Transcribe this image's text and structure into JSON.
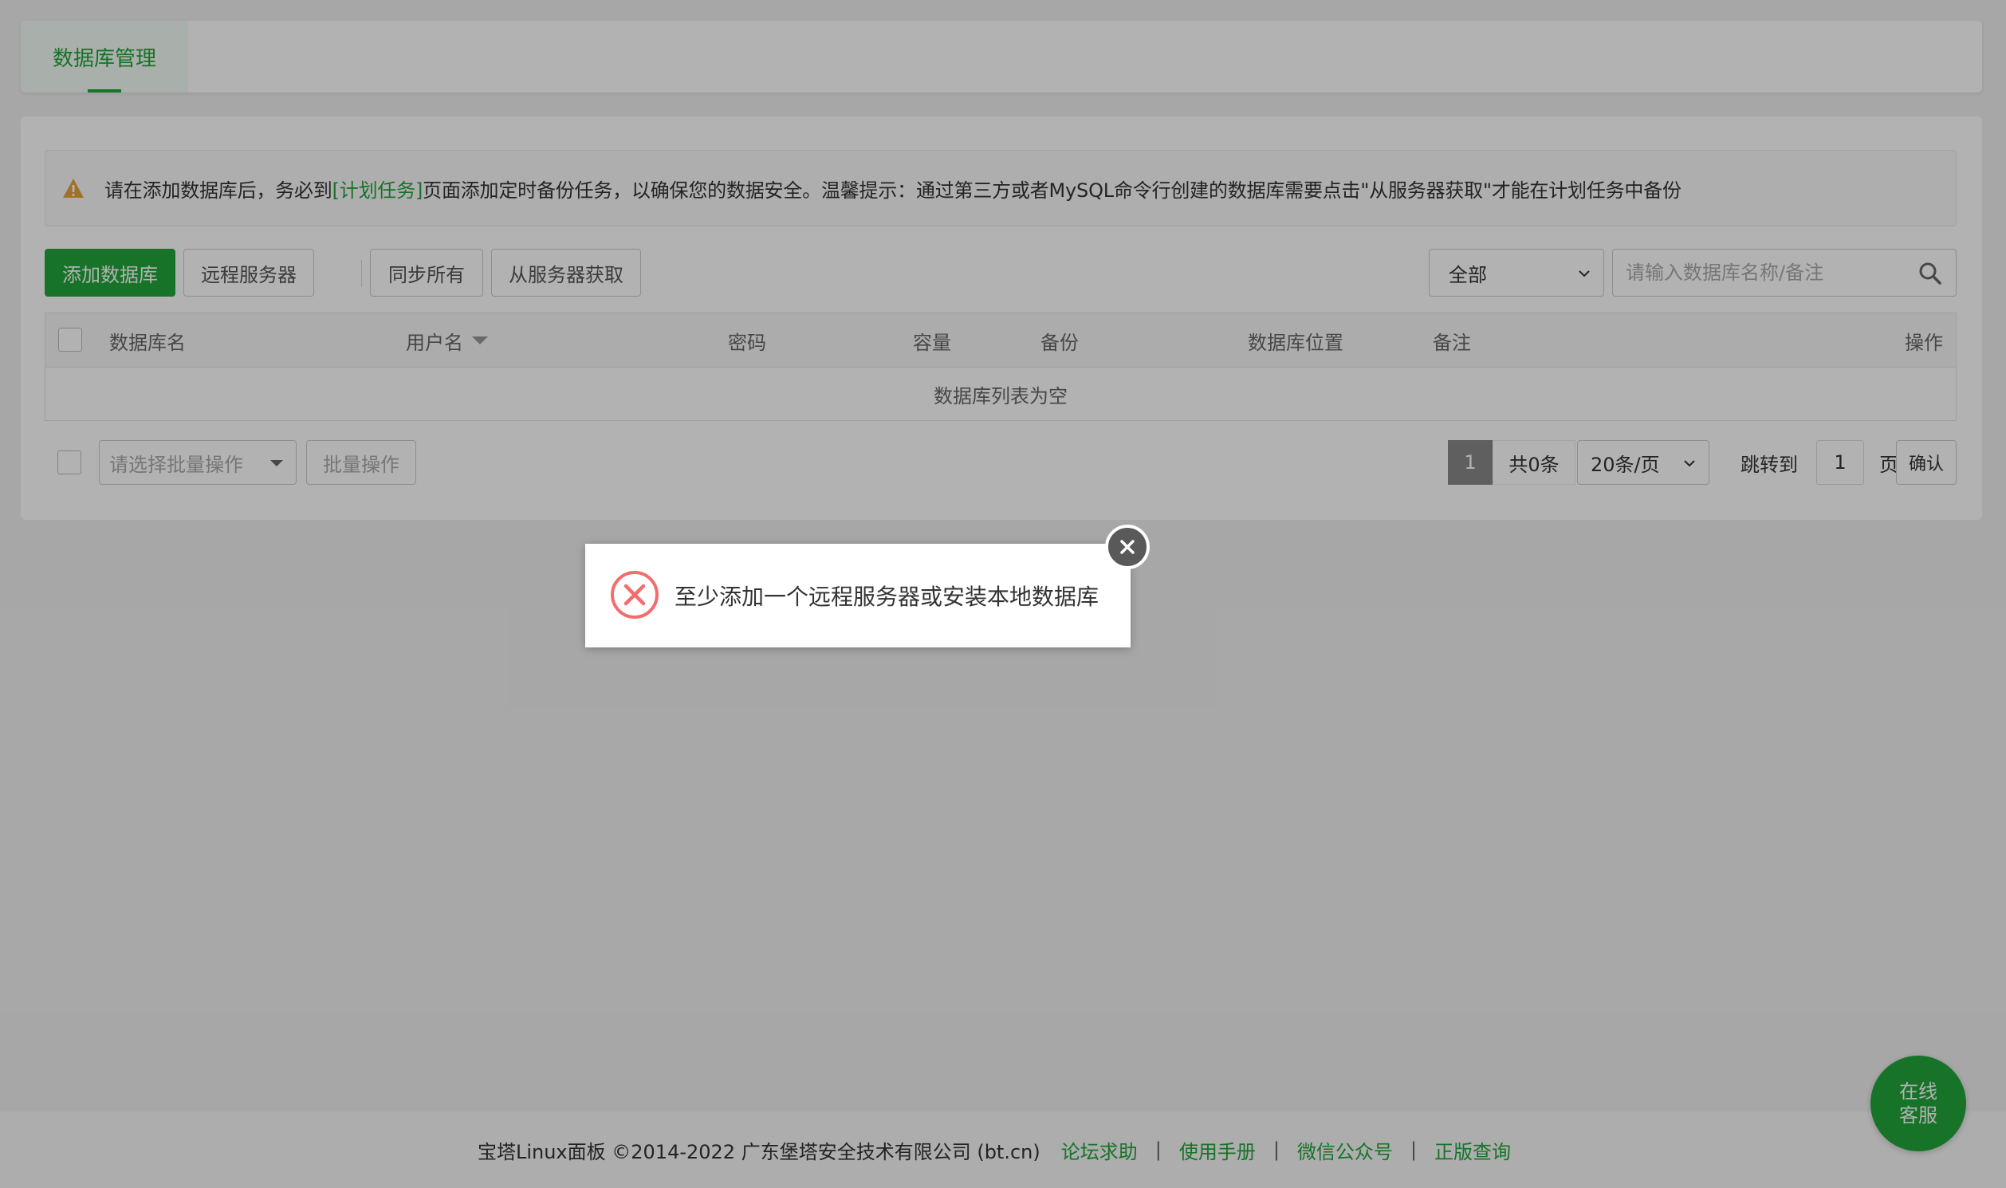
{
  "tabs": {
    "active": "数据库管理"
  },
  "alert": {
    "prefix": "请在添加数据库后，务必到",
    "link": "[计划任务]",
    "suffix": "页面添加定时备份任务，以确保您的数据安全。温馨提示：通过第三方或者MySQL命令行创建的数据库需要点击\"从服务器获取\"才能在计划任务中备份"
  },
  "toolbar": {
    "add_db": "添加数据库",
    "remote_server": "远程服务器",
    "sync_all": "同步所有",
    "fetch_from_server": "从服务器获取",
    "filter_selected": "全部",
    "search_placeholder": "请输入数据库名称/备注"
  },
  "table": {
    "columns": [
      "数据库名",
      "用户名",
      "密码",
      "容量",
      "备份",
      "数据库位置",
      "备注",
      "操作"
    ],
    "empty_text": "数据库列表为空"
  },
  "batch": {
    "select_placeholder": "请选择批量操作",
    "button": "批量操作"
  },
  "pager": {
    "current_page": "1",
    "total": "共0条",
    "page_size": "20条/页",
    "jump_label": "跳转到",
    "jump_value": "1",
    "page_unit": "页",
    "confirm": "确认"
  },
  "dialog": {
    "message": "至少添加一个远程服务器或安装本地数据库"
  },
  "service": {
    "line1": "在线",
    "line2": "客服"
  },
  "footer": {
    "copyright": "宝塔Linux面板 ©2014-2022 广东堡塔安全技术有限公司 (bt.cn)",
    "links": [
      "论坛求助",
      "使用手册",
      "微信公众号",
      "正版查询"
    ],
    "separator": "|"
  },
  "colors": {
    "accent": "#20a53a",
    "warning": "#e6a23c",
    "error": "#f56c6c"
  }
}
